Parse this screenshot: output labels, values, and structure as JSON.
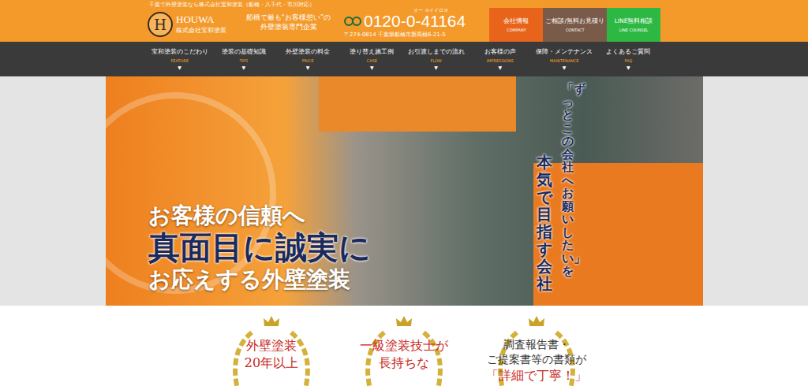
{
  "top_caption": "千葉で外壁塗装なら株式会社宝和塗装（船橋・八千代・市川対応）",
  "logo": {
    "mark": "H",
    "name": "HOUWA",
    "company": "株式会社宝和塗装"
  },
  "tagline": [
    "船橋で最も“お客様想い”の",
    "外壁塗装専門企業"
  ],
  "phone": {
    "ruby": "オー ヨイイロヨ",
    "number": "0120-0-41164",
    "address": "〒274-0814 千葉県船橋市新高根6-21-5"
  },
  "header_buttons": [
    {
      "label": "会社情報",
      "sub": "COMPANY",
      "color": "#e8641a"
    },
    {
      "label": "ご相談/無料お見積り",
      "sub": "CONTACT",
      "color": "#7a5a48"
    },
    {
      "label": "LINE無料相談",
      "sub": "LINE COUNSEL",
      "color": "#2db843"
    }
  ],
  "nav": [
    {
      "label": "宝和塗装のこだわり",
      "sub": "FEATURE",
      "arrow": "▼"
    },
    {
      "label": "塗装の基礎知識",
      "sub": "TIPS",
      "arrow": "▼"
    },
    {
      "label": "外壁塗装の料金",
      "sub": "PRICE",
      "arrow": "▼"
    },
    {
      "label": "塗り替え施工例",
      "sub": "CASE",
      "arrow": "▼"
    },
    {
      "label": "お引渡しまでの流れ",
      "sub": "FLOW",
      "arrow": "▼"
    },
    {
      "label": "お客様の声",
      "sub": "IMPRESSIONS",
      "arrow": "▼"
    },
    {
      "label": "保障・メンテナンス",
      "sub": "MAINTENANCE",
      "arrow": "▼"
    },
    {
      "label": "よくあるご質問",
      "sub": "FAQ",
      "arrow": "▼"
    }
  ],
  "hero": {
    "lines": [
      {
        "text": "お客様の信頼へ",
        "kind": "normal"
      },
      {
        "text": "真面目に誠実に",
        "kind": "large"
      },
      {
        "text": "お応えする外壁塗装",
        "kind": "normal"
      }
    ],
    "vertical": [
      "「ずっとこの会社へお願いしたい」を",
      "本気で目指す会社"
    ]
  },
  "badges": [
    {
      "lines": [
        {
          "text": "外壁塗装",
          "accent": true
        },
        {
          "text": "20年以上",
          "accent": true
        }
      ]
    },
    {
      "lines": [
        {
          "text": "一級塗装技士が",
          "accent": true
        },
        {
          "text": "長持ちな",
          "accent": true
        }
      ]
    },
    {
      "lines": [
        {
          "text": "調査報告書・",
          "accent": false
        },
        {
          "text": "ご提案書等の書類が",
          "accent": false
        },
        {
          "text": "「詳細で丁寧！」",
          "accent": true
        }
      ]
    }
  ]
}
